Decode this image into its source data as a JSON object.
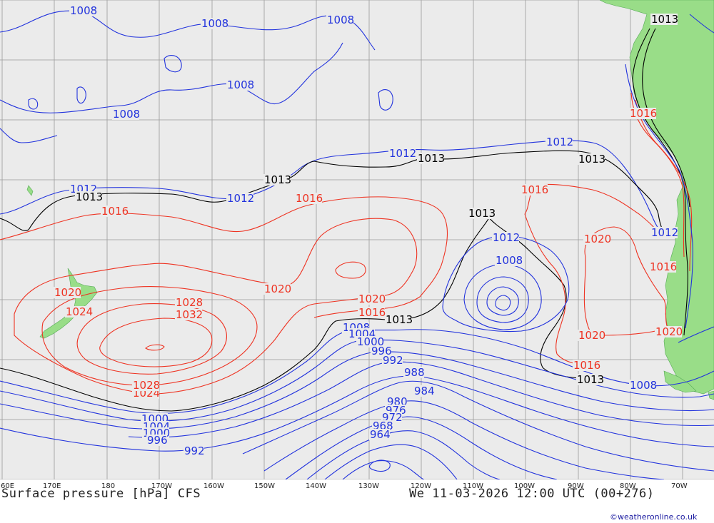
{
  "map": {
    "title": "Surface pressure [hPa] CFS",
    "valid_time": "We 11-03-2026 12:00 UTC (00+276)",
    "credit": "©weatheronline.co.uk",
    "colors": {
      "ocean": "#ebebeb",
      "land": "#99dd88",
      "grid": "#999999",
      "low": "#2233dd",
      "high": "#ee3322",
      "ref": "#000000"
    },
    "lon_labels": [
      "60E",
      "170E",
      "180",
      "170W",
      "160W",
      "150W",
      "140W",
      "130W",
      "120W",
      "110W",
      "100W",
      "90W",
      "80W",
      "70W"
    ],
    "isobar_labels": [
      {
        "text": "1008",
        "kind": "low"
      },
      {
        "text": "1008",
        "kind": "low"
      },
      {
        "text": "1008",
        "kind": "low"
      },
      {
        "text": "1008",
        "kind": "low"
      },
      {
        "text": "1008",
        "kind": "low"
      },
      {
        "text": "1012",
        "kind": "low"
      },
      {
        "text": "1012",
        "kind": "low"
      },
      {
        "text": "1012",
        "kind": "low"
      },
      {
        "text": "1012",
        "kind": "low"
      },
      {
        "text": "1012",
        "kind": "low"
      },
      {
        "text": "1012",
        "kind": "low"
      },
      {
        "text": "1013",
        "kind": "ref"
      },
      {
        "text": "1013",
        "kind": "ref"
      },
      {
        "text": "1013",
        "kind": "ref"
      },
      {
        "text": "1013",
        "kind": "ref"
      },
      {
        "text": "1013",
        "kind": "ref"
      },
      {
        "text": "1013",
        "kind": "ref"
      },
      {
        "text": "1013",
        "kind": "ref"
      },
      {
        "text": "1013",
        "kind": "ref"
      },
      {
        "text": "1016",
        "kind": "high"
      },
      {
        "text": "1016",
        "kind": "high"
      },
      {
        "text": "1016",
        "kind": "high"
      },
      {
        "text": "1016",
        "kind": "high"
      },
      {
        "text": "1016",
        "kind": "high"
      },
      {
        "text": "1016",
        "kind": "high"
      },
      {
        "text": "1016",
        "kind": "high"
      },
      {
        "text": "1020",
        "kind": "high"
      },
      {
        "text": "1020",
        "kind": "high"
      },
      {
        "text": "1020",
        "kind": "high"
      },
      {
        "text": "1020",
        "kind": "high"
      },
      {
        "text": "1020",
        "kind": "high"
      },
      {
        "text": "1020",
        "kind": "high"
      },
      {
        "text": "1024",
        "kind": "high"
      },
      {
        "text": "1024",
        "kind": "high"
      },
      {
        "text": "1028",
        "kind": "high"
      },
      {
        "text": "1028",
        "kind": "high"
      },
      {
        "text": "1032",
        "kind": "high"
      },
      {
        "text": "1008",
        "kind": "low"
      },
      {
        "text": "1004",
        "kind": "low"
      },
      {
        "text": "1000",
        "kind": "low"
      },
      {
        "text": "996",
        "kind": "low"
      },
      {
        "text": "992",
        "kind": "low"
      },
      {
        "text": "988",
        "kind": "low"
      },
      {
        "text": "984",
        "kind": "low"
      },
      {
        "text": "980",
        "kind": "low"
      },
      {
        "text": "976",
        "kind": "low"
      },
      {
        "text": "972",
        "kind": "low"
      },
      {
        "text": "968",
        "kind": "low"
      },
      {
        "text": "964",
        "kind": "low"
      },
      {
        "text": "1008",
        "kind": "low"
      },
      {
        "text": "1000",
        "kind": "low"
      },
      {
        "text": "1004",
        "kind": "low"
      },
      {
        "text": "1000",
        "kind": "low"
      },
      {
        "text": "996",
        "kind": "low"
      },
      {
        "text": "992",
        "kind": "low"
      },
      {
        "text": "1008",
        "kind": "low"
      }
    ]
  }
}
